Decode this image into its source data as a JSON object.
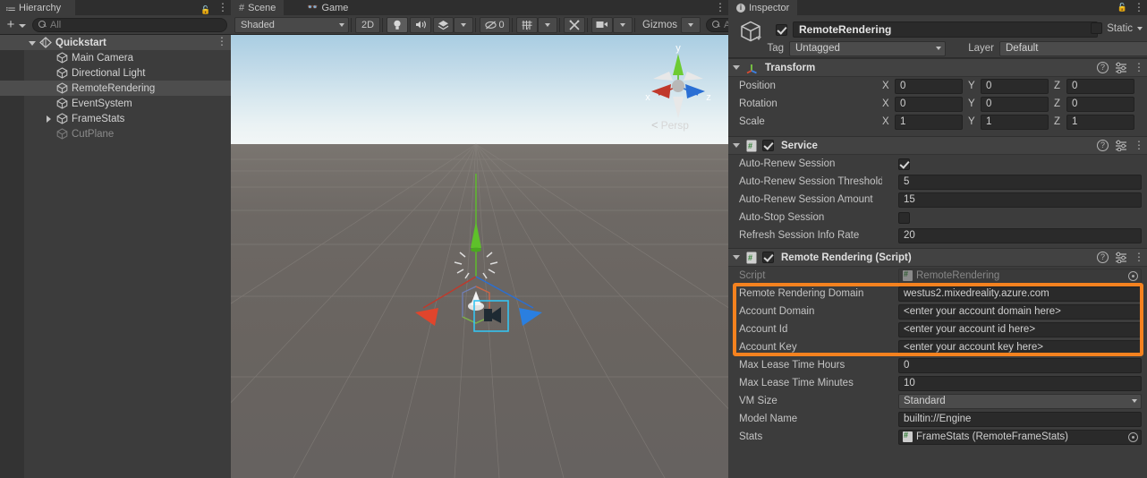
{
  "hierarchy": {
    "tab_label": "Hierarchy",
    "tab_icon": "hierarchy-icon",
    "lock_icon": "lock-open-icon",
    "menu_icon": "kebab-menu-icon",
    "create_label": "+",
    "search_placeholder": "All",
    "search_icon": "search-icon",
    "items": [
      {
        "label": "Quickstart",
        "indent": 0,
        "icon": "unity-scene-icon",
        "foldout": "open",
        "selected": true,
        "dim": false,
        "kebab": true
      },
      {
        "label": "Main Camera",
        "indent": 1,
        "icon": "game-object-icon",
        "foldout": "none",
        "selected": false,
        "dim": false,
        "kebab": false
      },
      {
        "label": "Directional Light",
        "indent": 1,
        "icon": "game-object-icon",
        "foldout": "none",
        "selected": false,
        "dim": false,
        "kebab": false
      },
      {
        "label": "RemoteRendering",
        "indent": 1,
        "icon": "game-object-icon",
        "foldout": "none",
        "selected": true,
        "dim": false,
        "kebab": false
      },
      {
        "label": "EventSystem",
        "indent": 1,
        "icon": "game-object-icon",
        "foldout": "none",
        "selected": false,
        "dim": false,
        "kebab": false
      },
      {
        "label": "FrameStats",
        "indent": 1,
        "icon": "game-object-icon",
        "foldout": "closed",
        "selected": false,
        "dim": false,
        "kebab": false
      },
      {
        "label": "CutPlane",
        "indent": 1,
        "icon": "game-object-icon",
        "foldout": "none",
        "selected": false,
        "dim": true,
        "kebab": false
      }
    ]
  },
  "scene": {
    "tabs": [
      {
        "label": "Scene",
        "icon": "grid-hash-icon",
        "active": true
      },
      {
        "label": "Game",
        "icon": "gamepad-icon",
        "active": false
      }
    ],
    "menu_icon": "kebab-menu-icon",
    "toolbar": {
      "shading_mode": "Shaded",
      "mode_2d": "2D",
      "lighting_icon": "lightbulb-icon",
      "audio_icon": "speaker-icon",
      "fx_icon": "effects-icon",
      "hidden_objects_icon": "eye-slash-icon",
      "hidden_objects_count": "0",
      "grid_icon": "grid-snap-icon",
      "tools_icon": "wrench-tools-icon",
      "camera_icon": "camera-icon",
      "gizmos_label": "Gizmos",
      "search_placeholder": "All",
      "search_icon": "search-icon"
    },
    "viewport": {
      "projection_label": "Persp",
      "projection_arrow_icon": "left-arrow-icon",
      "gizmo": {
        "axis_x": "x",
        "axis_y": "y",
        "axis_z": "z",
        "color_x": "#c0392b",
        "color_y": "#5ec12a",
        "color_z": "#2a6fd4"
      },
      "sky_top_color": "#a9cde2",
      "sky_horizon_color": "#f2f6f6",
      "ground_color": "#6b6662",
      "selection_outline_color": "#35c3f0"
    }
  },
  "inspector": {
    "tab_label": "Inspector",
    "tab_icon": "info-icon",
    "lock_icon": "lock-open-icon",
    "menu_icon": "kebab-menu-icon",
    "object": {
      "enabled": true,
      "name": "RemoteRendering",
      "icon": "game-object-icon",
      "static_label": "Static",
      "static_checked": false,
      "tag_label": "Tag",
      "tag_value": "Untagged",
      "layer_label": "Layer",
      "layer_value": "Default"
    },
    "components": [
      {
        "title": "Transform",
        "icon": "transform-axis-icon",
        "has_checkbox": false,
        "help_icon": "help-icon",
        "preset_icon": "preset-icon",
        "menu_icon": "kebab-menu-icon",
        "vector_rows": [
          {
            "label": "Position",
            "x": "0",
            "y": "0",
            "z": "0"
          },
          {
            "label": "Rotation",
            "x": "0",
            "y": "0",
            "z": "0"
          },
          {
            "label": "Scale",
            "x": "1",
            "y": "1",
            "z": "1"
          }
        ]
      },
      {
        "title": "Service",
        "icon": "cs-script-icon",
        "has_checkbox": true,
        "enabled": true,
        "help_icon": "help-icon",
        "preset_icon": "preset-icon",
        "menu_icon": "kebab-menu-icon",
        "rows": [
          {
            "label": "Auto-Renew Session",
            "type": "checkbox",
            "checked": true
          },
          {
            "label": "Auto-Renew Session Threshold",
            "type": "text",
            "value": "5"
          },
          {
            "label": "Auto-Renew Session Amount",
            "type": "text",
            "value": "15"
          },
          {
            "label": "Auto-Stop Session",
            "type": "checkbox",
            "checked": false
          },
          {
            "label": "Refresh Session Info Rate",
            "type": "text",
            "value": "20"
          }
        ]
      },
      {
        "title": "Remote Rendering (Script)",
        "icon": "cs-script-icon",
        "has_checkbox": true,
        "enabled": true,
        "help_icon": "help-icon",
        "preset_icon": "preset-icon",
        "menu_icon": "kebab-menu-icon",
        "rows": [
          {
            "label": "Script",
            "type": "object",
            "value": "RemoteRendering",
            "readonly": true
          },
          {
            "label": "Remote Rendering Domain",
            "type": "text",
            "value": "westus2.mixedreality.azure.com"
          },
          {
            "label": "Account Domain",
            "type": "text",
            "value": "<enter your account domain here>"
          },
          {
            "label": "Account Id",
            "type": "text",
            "value": "<enter your account id here>"
          },
          {
            "label": "Account Key",
            "type": "text",
            "value": "<enter your account key here>"
          },
          {
            "label": "Max Lease Time Hours",
            "type": "text",
            "value": "0"
          },
          {
            "label": "Max Lease Time Minutes",
            "type": "text",
            "value": "10"
          },
          {
            "label": "VM Size",
            "type": "dropdown",
            "value": "Standard"
          },
          {
            "label": "Model Name",
            "type": "text",
            "value": "builtin://Engine"
          },
          {
            "label": "Stats",
            "type": "object",
            "value": "FrameStats (RemoteFrameStats)",
            "readonly": false
          }
        ]
      }
    ],
    "annotation": {
      "highlight_color": "#f5821f",
      "highlight_target": "account-credentials-fields"
    }
  }
}
